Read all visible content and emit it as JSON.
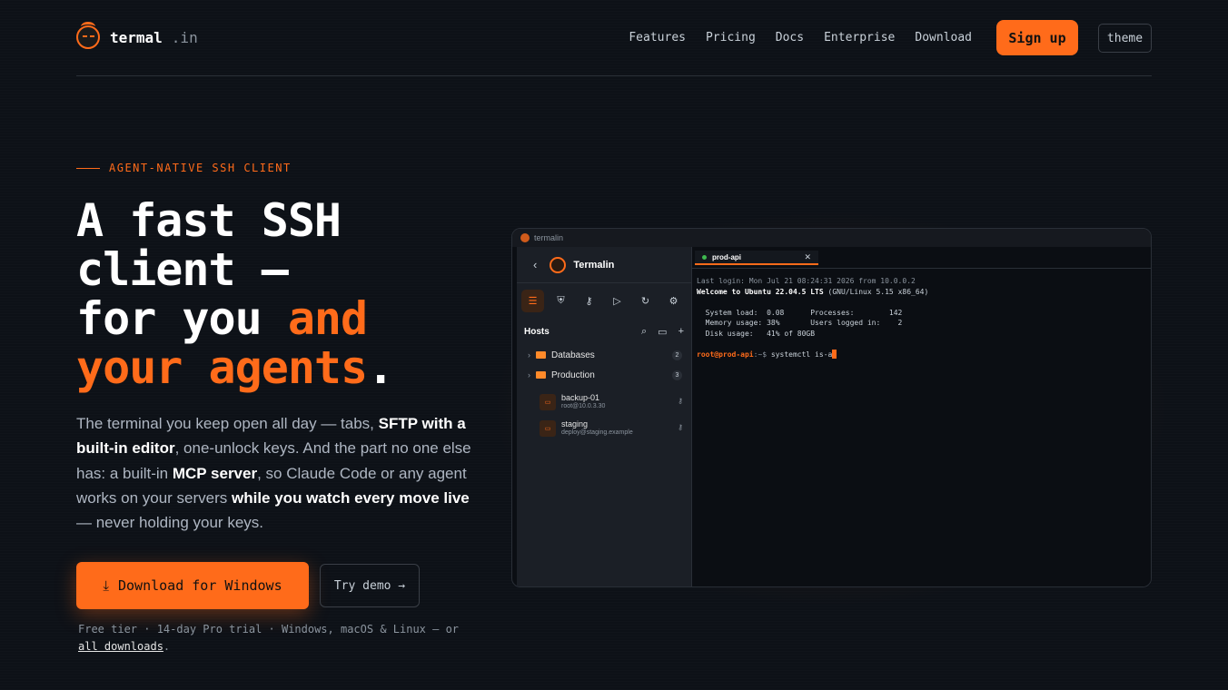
{
  "brand": {
    "name": "termal",
    "tld": ".in"
  },
  "nav": {
    "links": [
      "Features",
      "Pricing",
      "Docs",
      "Enterprise",
      "Download"
    ],
    "signup": "Sign up",
    "theme": "theme"
  },
  "hero": {
    "eyebrow": "AGENT-NATIVE SSH CLIENT",
    "headline": {
      "line1": "A fast SSH",
      "line2": "client —",
      "line3a": "for you ",
      "line3b": "and",
      "line4a": "your agents",
      "line4b": "."
    },
    "lede": {
      "p1": "The terminal you keep open all day — tabs, ",
      "b1": "SFTP with a built-in editor",
      "p2": ", one-unlock keys. And the part no one else has: a built-in ",
      "b2": "MCP server",
      "p3": ", so Claude Code or any agent works on your servers ",
      "b3": "while you watch every move live",
      "p4": " — never holding your keys."
    },
    "download_button": "Download for Windows",
    "demo_button": "Try demo →",
    "fine_print": "Free tier · 14-day Pro trial · Windows, macOS & Linux — or ",
    "fine_link": "all downloads",
    "fine_end": "."
  },
  "app": {
    "window_title": "termalin",
    "sidebar_title": "Termalin",
    "hosts_label": "Hosts",
    "groups": [
      {
        "name": "Databases",
        "count": "2"
      },
      {
        "name": "Production",
        "count": "3"
      }
    ],
    "hosts": [
      {
        "name": "backup-01",
        "addr": "root@10.0.3.30"
      },
      {
        "name": "staging",
        "addr": "deploy@staging.example"
      }
    ],
    "tab": "prod-api",
    "terminal": {
      "line1": "Last login: Mon Jul 21 08:24:31 2026 from 10.0.0.2",
      "line2a": "Welcome to Ubuntu 22.04.5 LTS",
      "line2b": " (GNU/Linux 5.15 x86_64)",
      "line3": "  System load:  0.08      Processes:        142",
      "line4": "  Memory usage: 38%       Users logged in:    2",
      "line5": "  Disk usage:   41% of 80GB",
      "prompt_user": "root@prod-api",
      "prompt_path": ":~$ ",
      "command": "systemctl is-a"
    }
  }
}
